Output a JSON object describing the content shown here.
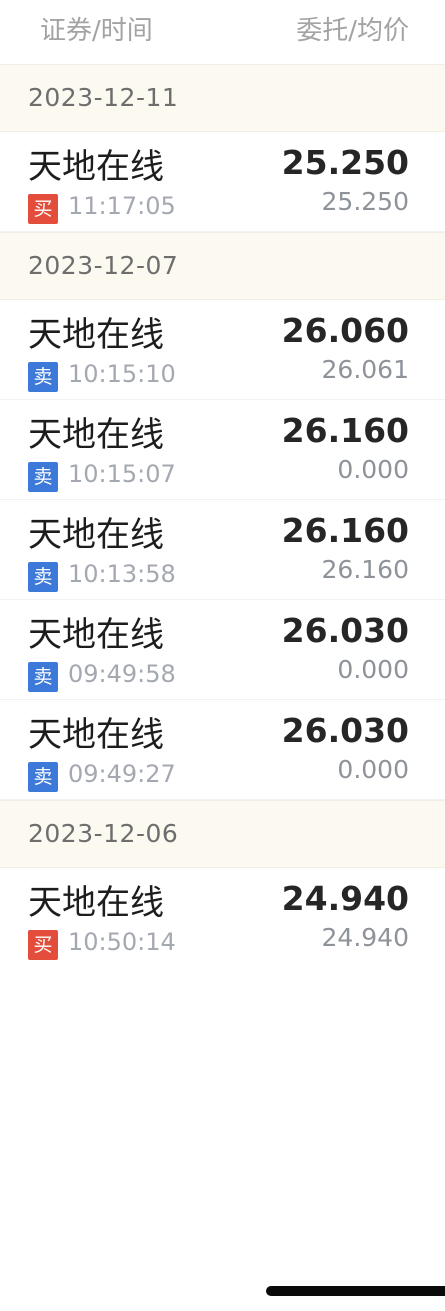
{
  "header": {
    "left_label": "证券/时间",
    "right_label": "委托/均价"
  },
  "groups": [
    {
      "date": "2023-12-11",
      "orders": [
        {
          "name": "天地在线",
          "side": "买",
          "side_type": "buy",
          "time": "11:17:05",
          "price": "25.250",
          "avg": "25.250"
        }
      ]
    },
    {
      "date": "2023-12-07",
      "orders": [
        {
          "name": "天地在线",
          "side": "卖",
          "side_type": "sell",
          "time": "10:15:10",
          "price": "26.060",
          "avg": "26.061"
        },
        {
          "name": "天地在线",
          "side": "卖",
          "side_type": "sell",
          "time": "10:15:07",
          "price": "26.160",
          "avg": "0.000"
        },
        {
          "name": "天地在线",
          "side": "卖",
          "side_type": "sell",
          "time": "10:13:58",
          "price": "26.160",
          "avg": "26.160"
        },
        {
          "name": "天地在线",
          "side": "卖",
          "side_type": "sell",
          "time": "09:49:58",
          "price": "26.030",
          "avg": "0.000"
        },
        {
          "name": "天地在线",
          "side": "卖",
          "side_type": "sell",
          "time": "09:49:27",
          "price": "26.030",
          "avg": "0.000"
        }
      ]
    },
    {
      "date": "2023-12-06",
      "orders": [
        {
          "name": "天地在线",
          "side": "买",
          "side_type": "buy",
          "time": "10:50:14",
          "price": "24.940",
          "avg": "24.940"
        }
      ]
    }
  ],
  "colors": {
    "buy_badge": "#e34e3c",
    "sell_badge": "#3d79d9",
    "date_band": "#fcf9f0"
  }
}
